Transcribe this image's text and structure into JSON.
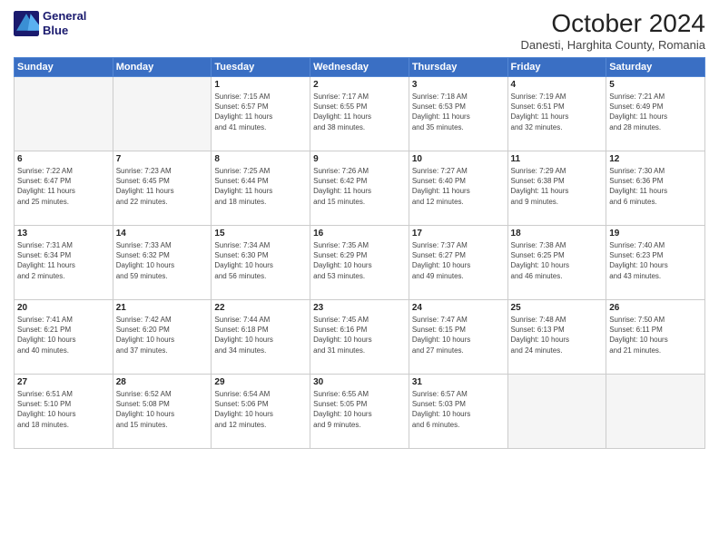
{
  "logo": {
    "line1": "General",
    "line2": "Blue"
  },
  "title": "October 2024",
  "subtitle": "Danesti, Harghita County, Romania",
  "weekdays": [
    "Sunday",
    "Monday",
    "Tuesday",
    "Wednesday",
    "Thursday",
    "Friday",
    "Saturday"
  ],
  "weeks": [
    [
      {
        "day": "",
        "info": ""
      },
      {
        "day": "",
        "info": ""
      },
      {
        "day": "1",
        "info": "Sunrise: 7:15 AM\nSunset: 6:57 PM\nDaylight: 11 hours\nand 41 minutes."
      },
      {
        "day": "2",
        "info": "Sunrise: 7:17 AM\nSunset: 6:55 PM\nDaylight: 11 hours\nand 38 minutes."
      },
      {
        "day": "3",
        "info": "Sunrise: 7:18 AM\nSunset: 6:53 PM\nDaylight: 11 hours\nand 35 minutes."
      },
      {
        "day": "4",
        "info": "Sunrise: 7:19 AM\nSunset: 6:51 PM\nDaylight: 11 hours\nand 32 minutes."
      },
      {
        "day": "5",
        "info": "Sunrise: 7:21 AM\nSunset: 6:49 PM\nDaylight: 11 hours\nand 28 minutes."
      }
    ],
    [
      {
        "day": "6",
        "info": "Sunrise: 7:22 AM\nSunset: 6:47 PM\nDaylight: 11 hours\nand 25 minutes."
      },
      {
        "day": "7",
        "info": "Sunrise: 7:23 AM\nSunset: 6:45 PM\nDaylight: 11 hours\nand 22 minutes."
      },
      {
        "day": "8",
        "info": "Sunrise: 7:25 AM\nSunset: 6:44 PM\nDaylight: 11 hours\nand 18 minutes."
      },
      {
        "day": "9",
        "info": "Sunrise: 7:26 AM\nSunset: 6:42 PM\nDaylight: 11 hours\nand 15 minutes."
      },
      {
        "day": "10",
        "info": "Sunrise: 7:27 AM\nSunset: 6:40 PM\nDaylight: 11 hours\nand 12 minutes."
      },
      {
        "day": "11",
        "info": "Sunrise: 7:29 AM\nSunset: 6:38 PM\nDaylight: 11 hours\nand 9 minutes."
      },
      {
        "day": "12",
        "info": "Sunrise: 7:30 AM\nSunset: 6:36 PM\nDaylight: 11 hours\nand 6 minutes."
      }
    ],
    [
      {
        "day": "13",
        "info": "Sunrise: 7:31 AM\nSunset: 6:34 PM\nDaylight: 11 hours\nand 2 minutes."
      },
      {
        "day": "14",
        "info": "Sunrise: 7:33 AM\nSunset: 6:32 PM\nDaylight: 10 hours\nand 59 minutes."
      },
      {
        "day": "15",
        "info": "Sunrise: 7:34 AM\nSunset: 6:30 PM\nDaylight: 10 hours\nand 56 minutes."
      },
      {
        "day": "16",
        "info": "Sunrise: 7:35 AM\nSunset: 6:29 PM\nDaylight: 10 hours\nand 53 minutes."
      },
      {
        "day": "17",
        "info": "Sunrise: 7:37 AM\nSunset: 6:27 PM\nDaylight: 10 hours\nand 49 minutes."
      },
      {
        "day": "18",
        "info": "Sunrise: 7:38 AM\nSunset: 6:25 PM\nDaylight: 10 hours\nand 46 minutes."
      },
      {
        "day": "19",
        "info": "Sunrise: 7:40 AM\nSunset: 6:23 PM\nDaylight: 10 hours\nand 43 minutes."
      }
    ],
    [
      {
        "day": "20",
        "info": "Sunrise: 7:41 AM\nSunset: 6:21 PM\nDaylight: 10 hours\nand 40 minutes."
      },
      {
        "day": "21",
        "info": "Sunrise: 7:42 AM\nSunset: 6:20 PM\nDaylight: 10 hours\nand 37 minutes."
      },
      {
        "day": "22",
        "info": "Sunrise: 7:44 AM\nSunset: 6:18 PM\nDaylight: 10 hours\nand 34 minutes."
      },
      {
        "day": "23",
        "info": "Sunrise: 7:45 AM\nSunset: 6:16 PM\nDaylight: 10 hours\nand 31 minutes."
      },
      {
        "day": "24",
        "info": "Sunrise: 7:47 AM\nSunset: 6:15 PM\nDaylight: 10 hours\nand 27 minutes."
      },
      {
        "day": "25",
        "info": "Sunrise: 7:48 AM\nSunset: 6:13 PM\nDaylight: 10 hours\nand 24 minutes."
      },
      {
        "day": "26",
        "info": "Sunrise: 7:50 AM\nSunset: 6:11 PM\nDaylight: 10 hours\nand 21 minutes."
      }
    ],
    [
      {
        "day": "27",
        "info": "Sunrise: 6:51 AM\nSunset: 5:10 PM\nDaylight: 10 hours\nand 18 minutes."
      },
      {
        "day": "28",
        "info": "Sunrise: 6:52 AM\nSunset: 5:08 PM\nDaylight: 10 hours\nand 15 minutes."
      },
      {
        "day": "29",
        "info": "Sunrise: 6:54 AM\nSunset: 5:06 PM\nDaylight: 10 hours\nand 12 minutes."
      },
      {
        "day": "30",
        "info": "Sunrise: 6:55 AM\nSunset: 5:05 PM\nDaylight: 10 hours\nand 9 minutes."
      },
      {
        "day": "31",
        "info": "Sunrise: 6:57 AM\nSunset: 5:03 PM\nDaylight: 10 hours\nand 6 minutes."
      },
      {
        "day": "",
        "info": ""
      },
      {
        "day": "",
        "info": ""
      }
    ]
  ]
}
